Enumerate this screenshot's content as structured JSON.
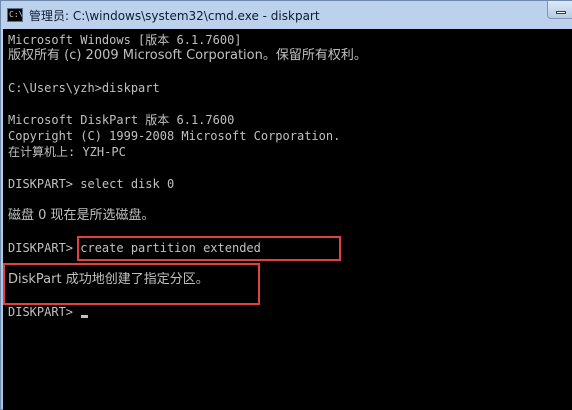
{
  "window": {
    "title": "管理员: C:\\windows\\system32\\cmd.exe - diskpart"
  },
  "console": {
    "lines": [
      "Microsoft Windows [版本 6.1.7600]",
      "版权所有 (c) 2009 Microsoft Corporation。保留所有权利。",
      "",
      "C:\\Users\\yzh>diskpart",
      "",
      "Microsoft DiskPart 版本 6.1.7600",
      "Copyright (C) 1999-2008 Microsoft Corporation.",
      "在计算机上: YZH-PC",
      "",
      "DISKPART> select disk 0",
      "",
      "磁盘 0 现在是所选磁盘。",
      "",
      "DISKPART> create partition extended",
      "",
      "DiskPart 成功地创建了指定分区。",
      "",
      "DISKPART> "
    ]
  },
  "colors": {
    "console_bg": "#000000",
    "console_text": "#c0c0c0",
    "highlight_border": "#e0413b",
    "titlebar": "#bcd2ec"
  },
  "icons": {
    "app": "cmd-icon",
    "cursor": "text-cursor"
  }
}
